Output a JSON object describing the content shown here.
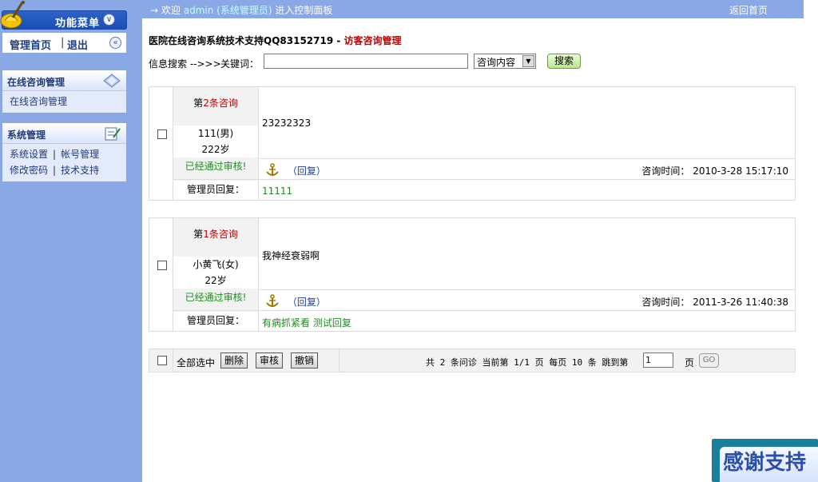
{
  "sidebar": {
    "menu_title": "功能菜单",
    "nav": {
      "home": "管理首页",
      "sep": "|",
      "logout": "退出"
    },
    "online_panel": {
      "title": "在线咨询管理",
      "items": [
        "在线咨询管理"
      ]
    },
    "system_panel": {
      "title": "系统管理",
      "items": [
        "系统设置",
        "帐号管理",
        "修改密码",
        "技术支持"
      ],
      "sep": "|"
    }
  },
  "topbar": {
    "arrow": "→",
    "welcome": "欢迎",
    "admin": "admin (系统管理员)",
    "suffix": "进入控制面板",
    "back": "返回首页"
  },
  "header": {
    "title": "医院在线咨询系统技术支持QQ83152719 -",
    "subtitle": "访客咨询管理"
  },
  "search": {
    "label": "信息搜索 -->>>",
    "keyword_label": "关键词：",
    "value": "",
    "select_value": "咨询内容",
    "button": "搜索"
  },
  "records": [
    {
      "num_prefix": "第",
      "num": "2条咨询",
      "name": "111(男)",
      "age": "222岁",
      "status": "已经通过审核!",
      "content": "23232323",
      "reply_link": "（回复）",
      "time_label": "咨询时间：",
      "time": "2010-3-28 15:17:10",
      "admin_label": "管理员回复：",
      "admin_reply": "11111"
    },
    {
      "num_prefix": "第",
      "num": "1条咨询",
      "name": "小黄飞(女)",
      "age": "22岁",
      "status": "已经通过审核!",
      "content": "我神经衰弱啊",
      "reply_link": "（回复）",
      "time_label": "咨询时间：",
      "time": "2011-3-26 11:40:38",
      "admin_label": "管理员回复：",
      "admin_reply": "有病抓紧看 测试回复"
    }
  ],
  "pager": {
    "select_all": "全部选中",
    "delete": "删除",
    "audit": "审核",
    "revoke": "撤销",
    "info": "共 2 条问诊 当前第 1/1 页 每页 10 条 跳到第",
    "page_value": "1",
    "page_unit": "页",
    "go": "GO"
  },
  "badge": {
    "text": "感谢支持"
  }
}
